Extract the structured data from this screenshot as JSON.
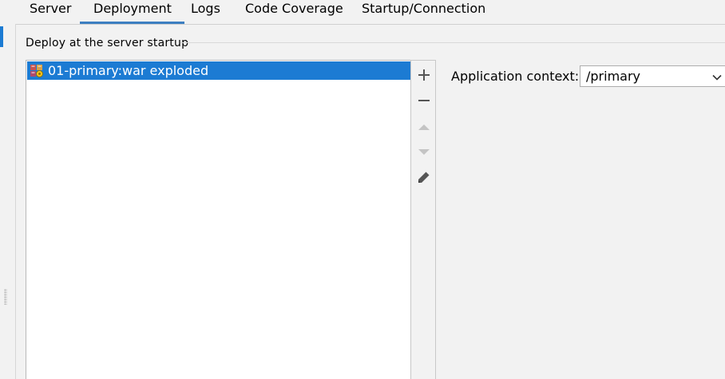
{
  "tabs": [
    {
      "label": "Server"
    },
    {
      "label": "Deployment"
    },
    {
      "label": "Logs"
    },
    {
      "label": "Code Coverage"
    },
    {
      "label": "Startup/Connection"
    }
  ],
  "active_tab": "Deployment",
  "deploy_group": {
    "title": "Deploy at the server startup",
    "items": [
      {
        "label": "01-primary:war exploded",
        "icon": "war-exploded-artifact-icon",
        "selected": true
      }
    ]
  },
  "toolbar": {
    "add_icon": "plus-icon",
    "remove_icon": "minus-icon",
    "move_up_icon": "triangle-up-icon",
    "move_down_icon": "triangle-down-icon",
    "edit_icon": "pencil-icon"
  },
  "app_context": {
    "label": "Application context:",
    "value": "/primary"
  },
  "colors": {
    "selection": "#1c7bd3",
    "tab_underline": "#3d7fc1",
    "background": "#f2f2f2"
  }
}
